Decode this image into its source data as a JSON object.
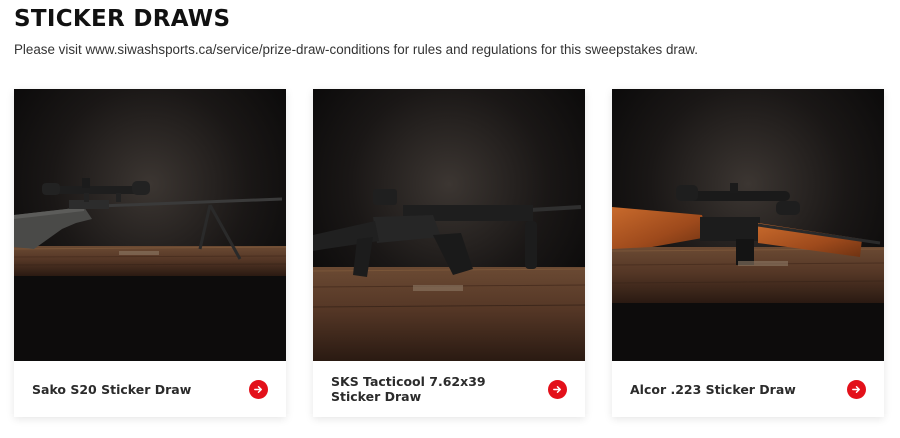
{
  "header": {
    "title": "STICKER DRAWS",
    "subtitle": "Please visit www.siwashsports.ca/service/prize-draw-conditions for rules and regulations for this sweepstakes draw."
  },
  "cards": [
    {
      "label": "Sako S20 Sticker Draw",
      "icon": "arrow-right-icon"
    },
    {
      "label": "SKS Tacticool 7.62x39 Sticker Draw",
      "icon": "arrow-right-icon"
    },
    {
      "label": "Alcor .223 Sticker Draw",
      "icon": "arrow-right-icon"
    }
  ],
  "colors": {
    "accent": "#e3101a",
    "photo_background": "#141212",
    "table_wood": "#5a3a26"
  }
}
